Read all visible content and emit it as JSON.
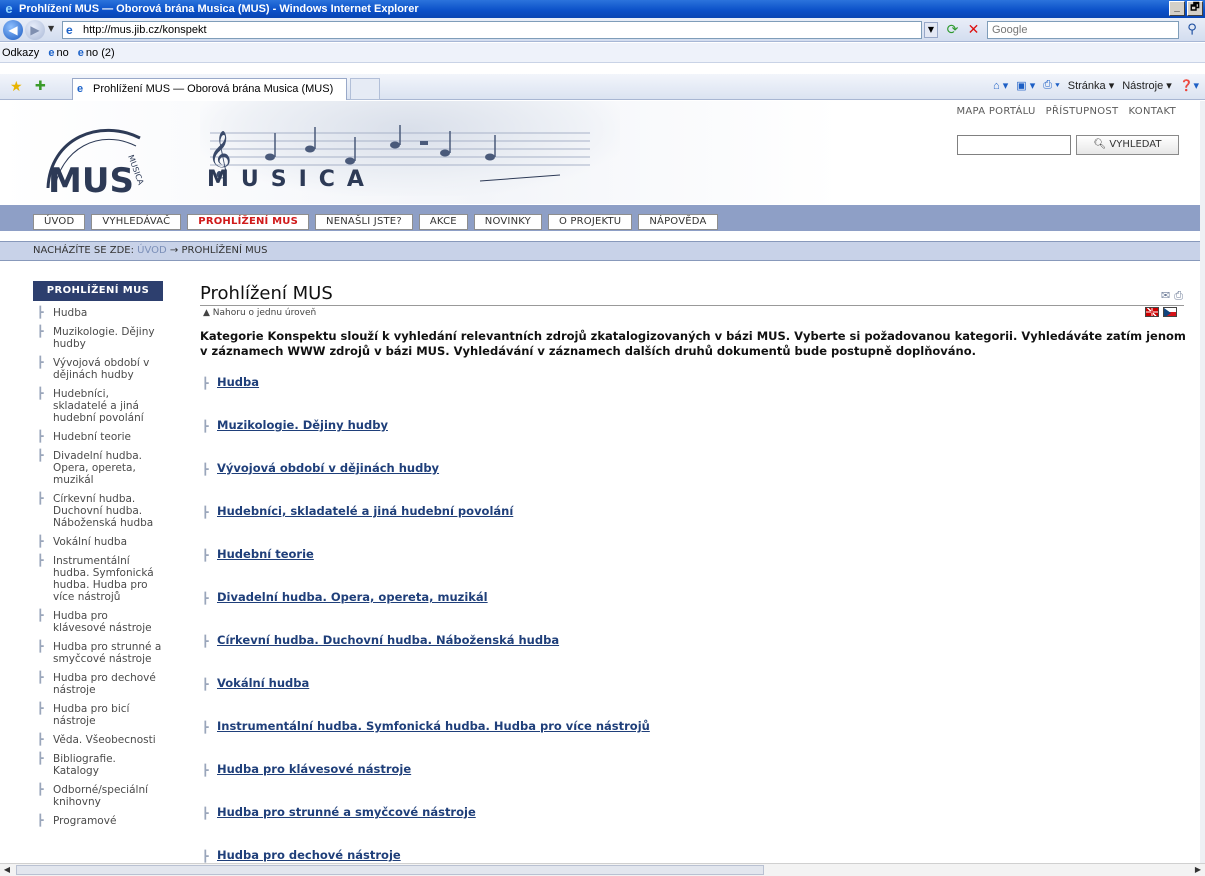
{
  "window": {
    "title": "Prohlížení MUS — Oborová brána Musica (MUS) - Windows Internet Explorer",
    "buttons": [
      "_",
      "🗗"
    ]
  },
  "addressbar": {
    "url": "http://mus.jib.cz/konspekt",
    "search_placeholder": "Google"
  },
  "linksbar": {
    "label": "Odkazy",
    "items": [
      "no",
      "no (2)"
    ]
  },
  "tabbar": {
    "active_tab": "Prohlížení MUS — Oborová brána Musica (MUS)",
    "cmd_page": "Stránka",
    "cmd_tools": "Nástroje"
  },
  "header": {
    "logo_text": "MUS",
    "site_name": "MUSICA",
    "top_links": [
      "MAPA PORTÁLU",
      "PŘÍSTUPNOST",
      "KONTAKT"
    ],
    "search_button": "VYHLEDAT"
  },
  "menu": {
    "items": [
      "ÚVOD",
      "VYHLEDÁVAČ",
      "PROHLÍŽENÍ MUS",
      "NENAŠLI JSTE?",
      "AKCE",
      "NOVINKY",
      "O PROJEKTU",
      "NÁPOVĚDA"
    ],
    "active": "PROHLÍŽENÍ MUS"
  },
  "breadcrumb": {
    "prefix": "NACHÁZÍTE SE ZDE:",
    "home": "ÚVOD",
    "arrow": "→",
    "current": "PROHLÍŽENÍ MUS"
  },
  "sidebar": {
    "heading": "PROHLÍŽENÍ MUS",
    "items": [
      "Hudba",
      "Muzikologie. Dějiny hudby",
      "Vývojová období v dějinách hudby",
      "Hudebníci, skladatelé a jiná hudební povolání",
      "Hudební teorie",
      "Divadelní hudba. Opera, opereta, muzikál",
      "Církevní hudba. Duchovní hudba. Náboženská hudba",
      "Vokální hudba",
      "Instrumentální hudba. Symfonická hudba. Hudba pro více nástrojů",
      "Hudba pro klávesové nástroje",
      "Hudba pro strunné a smyčcové nástroje",
      "Hudba pro dechové nástroje",
      "Hudba pro bicí nástroje",
      "Věda. Všeobecnosti",
      "Bibliografie. Katalogy",
      "Odborné/speciální knihovny",
      "Programové"
    ]
  },
  "main": {
    "title": "Prohlížení MUS",
    "up_link": "Nahoru o jednu úroveň",
    "intro": "Kategorie Konspektu slouží k vyhledání relevantních zdrojů zkatalogizovaných v bázi MUS. Vyberte si požadovanou kategorii. Vyhledáváte zatím jenom v záznamech WWW zdrojů v bázi MUS. Vyhledávání v záznamech dalších druhů dokumentů bude postupně doplňováno.",
    "categories": [
      "Hudba",
      "Muzikologie. Dějiny hudby",
      "Vývojová období v dějinách hudby",
      "Hudebníci, skladatelé a jiná hudební povolání",
      "Hudební teorie",
      "Divadelní hudba. Opera, opereta, muzikál",
      "Církevní hudba. Duchovní hudba. Náboženská hudba",
      "Vokální hudba",
      "Instrumentální hudba. Symfonická hudba. Hudba pro více nástrojů",
      "Hudba pro klávesové nástroje",
      "Hudba pro strunné a smyčcové nástroje",
      "Hudba pro dechové nástroje"
    ]
  },
  "colors": {
    "menubar": "#8e9fc6",
    "active_menu": "#d01a1a",
    "sidebar_head": "#2d3f6e",
    "link": "#1f3f7a"
  }
}
